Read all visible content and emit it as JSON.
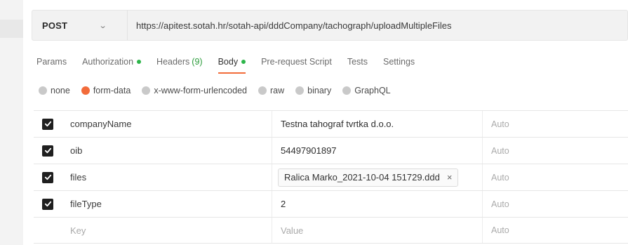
{
  "request": {
    "method": "POST",
    "url": "https://apitest.sotah.hr/sotah-api/dddCompany/tachograph/uploadMultipleFiles"
  },
  "tabs": [
    {
      "label": "Params",
      "dot": false,
      "count": "",
      "active": false
    },
    {
      "label": "Authorization",
      "dot": true,
      "count": "",
      "active": false
    },
    {
      "label": "Headers",
      "dot": false,
      "count": "(9)",
      "active": false
    },
    {
      "label": "Body",
      "dot": true,
      "count": "",
      "active": true
    },
    {
      "label": "Pre-request Script",
      "dot": false,
      "count": "",
      "active": false
    },
    {
      "label": "Tests",
      "dot": false,
      "count": "",
      "active": false
    },
    {
      "label": "Settings",
      "dot": false,
      "count": "",
      "active": false
    }
  ],
  "body_types": [
    {
      "label": "none",
      "selected": false
    },
    {
      "label": "form-data",
      "selected": true
    },
    {
      "label": "x-www-form-urlencoded",
      "selected": false
    },
    {
      "label": "raw",
      "selected": false
    },
    {
      "label": "binary",
      "selected": false
    },
    {
      "label": "GraphQL",
      "selected": false
    }
  ],
  "form_rows": [
    {
      "checked": true,
      "key": "companyName",
      "value": "Testna tahograf tvrtka d.o.o.",
      "is_file": false,
      "description": "Auto"
    },
    {
      "checked": true,
      "key": "oib",
      "value": "54497901897",
      "is_file": false,
      "description": "Auto"
    },
    {
      "checked": true,
      "key": "files",
      "value": "Ralica Marko_2021-10-04 151729.ddd",
      "is_file": true,
      "file_remove": "×",
      "description": "Auto"
    },
    {
      "checked": true,
      "key": "fileType",
      "value": "2",
      "is_file": false,
      "description": "Auto"
    }
  ],
  "new_row": {
    "key_placeholder": "Key",
    "value_placeholder": "Value",
    "description": "Auto"
  },
  "method_chevron": "⌄",
  "colors": {
    "accent": "#f26b3a",
    "status_dot": "#2db54a",
    "headers_count": "#2a9b3a"
  }
}
